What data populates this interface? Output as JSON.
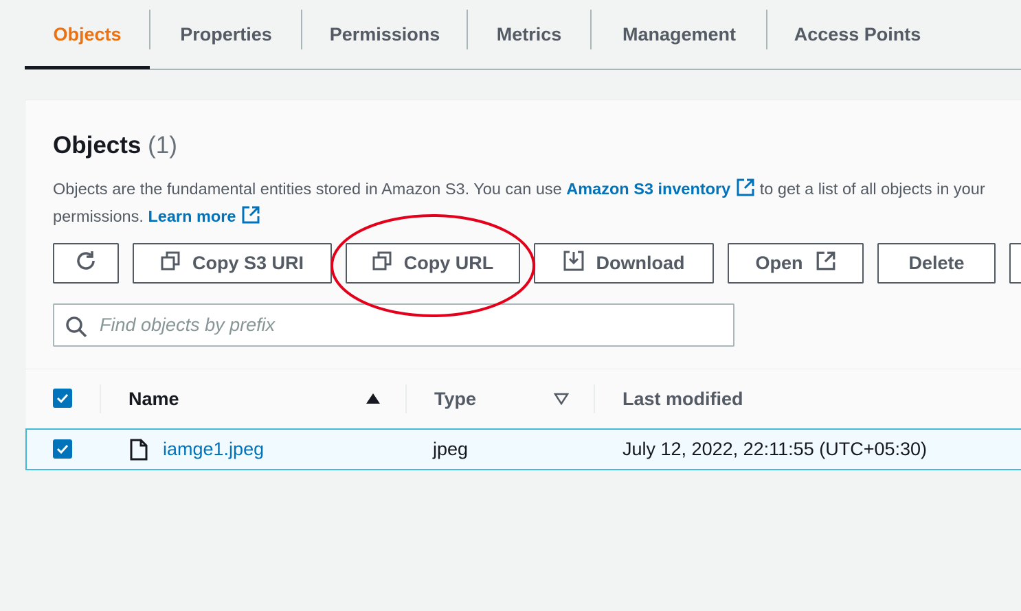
{
  "tabs": [
    {
      "label": "Objects",
      "active": true
    },
    {
      "label": "Properties"
    },
    {
      "label": "Permissions"
    },
    {
      "label": "Metrics"
    },
    {
      "label": "Management"
    },
    {
      "label": "Access Points"
    }
  ],
  "objects_panel": {
    "title": "Objects",
    "count": "(1)",
    "description_part1": "Objects are the fundamental entities stored in Amazon S3. You can use",
    "inventory_link": "Amazon S3 inventory",
    "description_part2": "to get a list of all objects in your",
    "description_line2": "permissions.",
    "learn_more_link": "Learn more"
  },
  "toolbar": {
    "refresh_icon": "refresh-icon",
    "copy_s3_uri": "Copy S3 URI",
    "copy_url": "Copy URL",
    "download": "Download",
    "open": "Open",
    "delete": "Delete"
  },
  "search": {
    "placeholder": "Find objects by prefix",
    "value": ""
  },
  "table": {
    "columns": [
      {
        "label": "Name",
        "sort": "ascending"
      },
      {
        "label": "Type",
        "sort": "none"
      },
      {
        "label": "Last modified"
      }
    ],
    "rows": [
      {
        "selected": true,
        "name": "iamge1.jpeg",
        "type": "jpeg",
        "last_modified": "July 12, 2022, 22:11:55 (UTC+05:30)"
      }
    ]
  },
  "colors": {
    "accent_orange": "#ec7211",
    "link_blue": "#0073bb",
    "annotation_red": "#e3001b",
    "row_highlight": "#f1faff"
  }
}
